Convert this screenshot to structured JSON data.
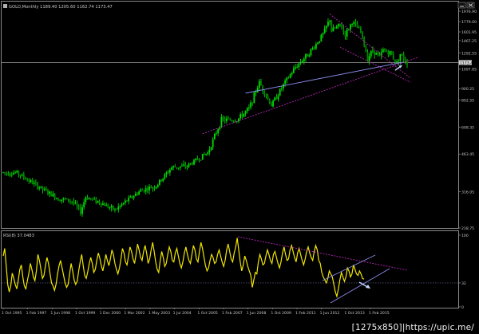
{
  "main_window": {
    "header_text": "GOLD,Monthly 1189.40 1205.60 1162.74 1173.47",
    "current_price_tag": "1173.47",
    "window_controls": [
      "minimize",
      "close"
    ]
  },
  "indicator_window": {
    "header_text": "RSI(8) 37.0483"
  },
  "watermark": {
    "size_text": "[1275x850]",
    "separator": " | ",
    "url_text": "https://upic.me/"
  },
  "colors": {
    "background": "#000000",
    "candles": "#00dd00",
    "candles_low": "#008800",
    "rsi_line": "#f0e600",
    "axis_text": "#c8c8c8",
    "frame": "#8a8a8a",
    "price_line": "#bcbcbc",
    "trend_magenta": "#b428b4",
    "trend_blue": "#8c8cf0",
    "arrow": "#c8d8ff"
  },
  "chart_data": [
    {
      "type": "candlestick",
      "title": "GOLD,Monthly 1189.40 1205.60 1162.74 1173.47",
      "symbol": "GOLD",
      "timeframe": "Monthly",
      "last_bar": {
        "open": 1189.4,
        "high": 1205.6,
        "low": 1162.74,
        "close": 1173.47
      },
      "y_ticks": [
        "1976.90",
        "1779.00",
        "1601.95",
        "1467.25",
        "1292.55",
        "1173.47",
        "1097.85",
        "900.25",
        "802.55",
        "608.35",
        "463.45",
        "316.05",
        "218.75"
      ],
      "y_scale": "log",
      "ylim": [
        218.75,
        2076
      ],
      "x_ticks": [
        "1 Oct 1995",
        "1 Feb 1997",
        "1 Jun 1998",
        "1 Oct 1999",
        "1 Dec 2000",
        "1 Mar 2002",
        "1 May 2003",
        "1 Jul 2004",
        "1 Oct 2005",
        "1 Feb 2007",
        "1 Jun 2008",
        "1 Oct 2009",
        "1 Feb 2011",
        "1 Jun 2012",
        "1 Oct 2013",
        "1 Feb 2015"
      ],
      "x_range": [
        "1995-10",
        "2015-05"
      ],
      "series_anchors": [
        {
          "x": "1995-10",
          "y": 384
        },
        {
          "x": "1996-06",
          "y": 383
        },
        {
          "x": "1997-02",
          "y": 350
        },
        {
          "x": "1997-10",
          "y": 320
        },
        {
          "x": "1998-06",
          "y": 295
        },
        {
          "x": "1999-02",
          "y": 288
        },
        {
          "x": "1999-07",
          "y": 258
        },
        {
          "x": "1999-10",
          "y": 300
        },
        {
          "x": "2000-06",
          "y": 285
        },
        {
          "x": "2001-03",
          "y": 262
        },
        {
          "x": "2001-09",
          "y": 285
        },
        {
          "x": "2002-06",
          "y": 320
        },
        {
          "x": "2003-03",
          "y": 335
        },
        {
          "x": "2003-12",
          "y": 405
        },
        {
          "x": "2004-09",
          "y": 410
        },
        {
          "x": "2005-09",
          "y": 470
        },
        {
          "x": "2006-05",
          "y": 655
        },
        {
          "x": "2007-02",
          "y": 655
        },
        {
          "x": "2007-09",
          "y": 735
        },
        {
          "x": "2008-03",
          "y": 960
        },
        {
          "x": "2008-10",
          "y": 760
        },
        {
          "x": "2009-05",
          "y": 935
        },
        {
          "x": "2009-12",
          "y": 1120
        },
        {
          "x": "2010-06",
          "y": 1250
        },
        {
          "x": "2010-11",
          "y": 1380
        },
        {
          "x": "2011-04",
          "y": 1560
        },
        {
          "x": "2011-08",
          "y": 1825
        },
        {
          "x": "2011-09",
          "y": 1620
        },
        {
          "x": "2012-02",
          "y": 1720
        },
        {
          "x": "2012-05",
          "y": 1560
        },
        {
          "x": "2012-09",
          "y": 1775
        },
        {
          "x": "2013-02",
          "y": 1600
        },
        {
          "x": "2013-06",
          "y": 1230
        },
        {
          "x": "2013-09",
          "y": 1330
        },
        {
          "x": "2014-01",
          "y": 1240
        },
        {
          "x": "2014-03",
          "y": 1330
        },
        {
          "x": "2014-07",
          "y": 1295
        },
        {
          "x": "2014-11",
          "y": 1170
        },
        {
          "x": "2015-01",
          "y": 1280
        },
        {
          "x": "2015-05",
          "y": 1173
        }
      ],
      "trendlines": [
        {
          "color": "trend_magenta",
          "style": "dashed",
          "from": {
            "x": "2005-06",
            "y": 570
          },
          "to": {
            "x": "2015-11",
            "y": 1235
          }
        },
        {
          "color": "trend_magenta",
          "style": "dashed",
          "from": {
            "x": "2011-08",
            "y": 1920
          },
          "to": {
            "x": "2015-07",
            "y": 1000
          }
        },
        {
          "color": "trend_magenta",
          "style": "dashed",
          "from": {
            "x": "2012-02",
            "y": 1370
          },
          "to": {
            "x": "2015-07",
            "y": 960
          }
        },
        {
          "color": "trend_blue",
          "style": "solid",
          "from": {
            "x": "2007-07",
            "y": 860
          },
          "to": {
            "x": "2015-03",
            "y": 1180
          }
        }
      ],
      "arrows": [
        {
          "from": {
            "x": "2014-10",
            "y": 1085
          },
          "to": {
            "x": "2015-02",
            "y": 1140
          }
        }
      ],
      "horizontal_line": 1173.47
    },
    {
      "type": "line",
      "title": "RSI(8) 37.0483",
      "indicator": "RSI",
      "period": 8,
      "last_value": 37.0483,
      "y_ticks": [
        "100",
        "32",
        "0"
      ],
      "ylim": [
        0,
        100
      ],
      "level_line": 32,
      "series": [
        {
          "values": [
            68,
            78,
            55,
            30,
            20,
            28,
            45,
            38,
            30,
            24,
            36,
            50,
            56,
            40,
            28,
            24,
            35,
            45,
            58,
            50,
            40,
            35,
            48,
            70,
            62,
            50,
            38,
            42,
            55,
            66,
            58,
            45,
            32,
            28,
            22,
            30,
            44,
            55,
            62,
            52,
            42,
            32,
            26,
            30,
            44,
            58,
            48,
            36,
            30,
            34,
            48,
            60,
            70,
            55,
            42,
            38,
            47,
            58,
            66,
            58,
            46,
            50,
            62,
            72,
            65,
            55,
            48,
            58,
            70,
            62,
            55,
            64,
            76,
            70,
            58,
            50,
            44,
            52,
            64,
            78,
            72,
            60,
            56,
            68,
            80,
            74,
            64,
            58,
            70,
            84,
            76,
            66,
            62,
            74,
            82,
            72,
            58,
            64,
            76,
            86,
            74,
            60,
            50,
            46,
            62,
            74,
            66,
            54,
            58,
            70,
            80,
            74,
            62,
            60,
            72,
            78,
            68,
            58,
            52,
            60,
            72,
            80,
            70,
            62,
            58,
            70,
            82,
            76,
            64,
            60,
            74,
            86,
            78,
            66,
            55,
            48,
            52,
            62,
            70,
            66,
            58,
            60,
            70,
            76,
            68,
            60,
            54,
            62,
            76,
            84,
            74,
            64,
            60,
            72,
            80,
            92,
            76,
            60,
            48,
            56,
            68,
            62,
            54,
            48,
            42,
            26,
            36,
            46,
            44,
            60,
            70,
            64,
            56,
            58,
            68,
            76,
            70,
            62,
            58,
            70,
            74,
            66,
            58,
            52,
            60,
            72,
            80,
            70,
            62,
            64,
            76,
            82,
            74,
            66,
            60,
            72,
            78,
            70,
            62,
            56,
            64,
            74,
            80,
            72,
            66,
            62,
            74,
            82,
            76,
            62,
            58,
            46,
            40,
            36,
            32,
            38,
            48,
            44,
            40,
            30,
            20,
            14,
            24,
            36,
            46,
            40,
            34,
            40,
            52,
            48,
            40,
            44,
            56,
            50,
            44,
            42,
            48,
            44,
            38,
            37
          ]
        }
      ]
    }
  ]
}
